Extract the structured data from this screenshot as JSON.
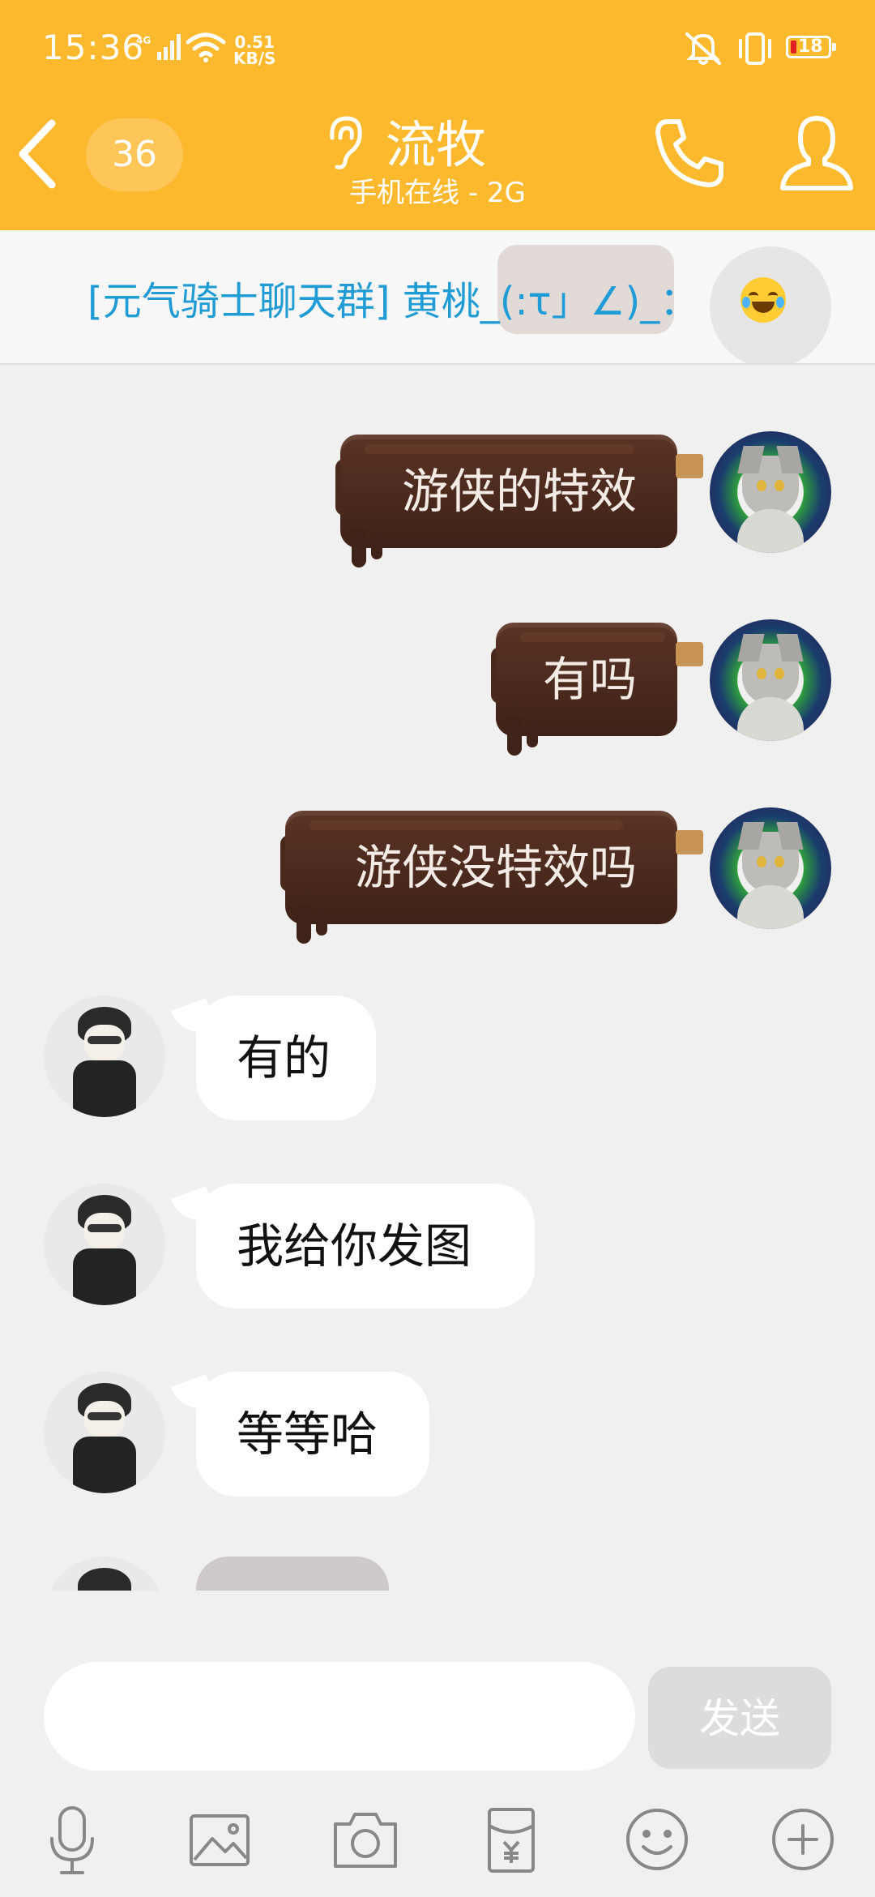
{
  "status_bar": {
    "time": "15:36",
    "signal": "4G",
    "net_speed_value": "0.51",
    "net_speed_unit": "KB/S",
    "battery": "18"
  },
  "header": {
    "back_icon": "chevron-left-icon",
    "unread_count": "36",
    "title": "流牧",
    "subtitle": "手机在线 - 2G",
    "call_icon": "phone-icon",
    "profile_icon": "person-icon"
  },
  "notification": {
    "text": "[元气骑士聊天群] 黄桃_(:τ」∠)_：",
    "emoji": "laugh-cry-emoji"
  },
  "messages": [
    {
      "side": "out",
      "text": "游侠的特效"
    },
    {
      "side": "out",
      "text": "有吗"
    },
    {
      "side": "out",
      "text": "游侠没特效吗"
    },
    {
      "side": "in",
      "text": "有的"
    },
    {
      "side": "in",
      "text": "我给你发图"
    },
    {
      "side": "in",
      "text": "等等哈"
    }
  ],
  "composer": {
    "input_value": "",
    "send_label": "发送"
  },
  "toolbar": [
    "microphone-icon",
    "image-icon",
    "camera-icon",
    "red-packet-icon",
    "emoji-icon",
    "plus-icon"
  ],
  "colors": {
    "header_bg": "#fdb92d",
    "notice_text": "#1f9bd5",
    "bubble_out": "#4a291d",
    "chat_bg": "#f0f0f0"
  }
}
